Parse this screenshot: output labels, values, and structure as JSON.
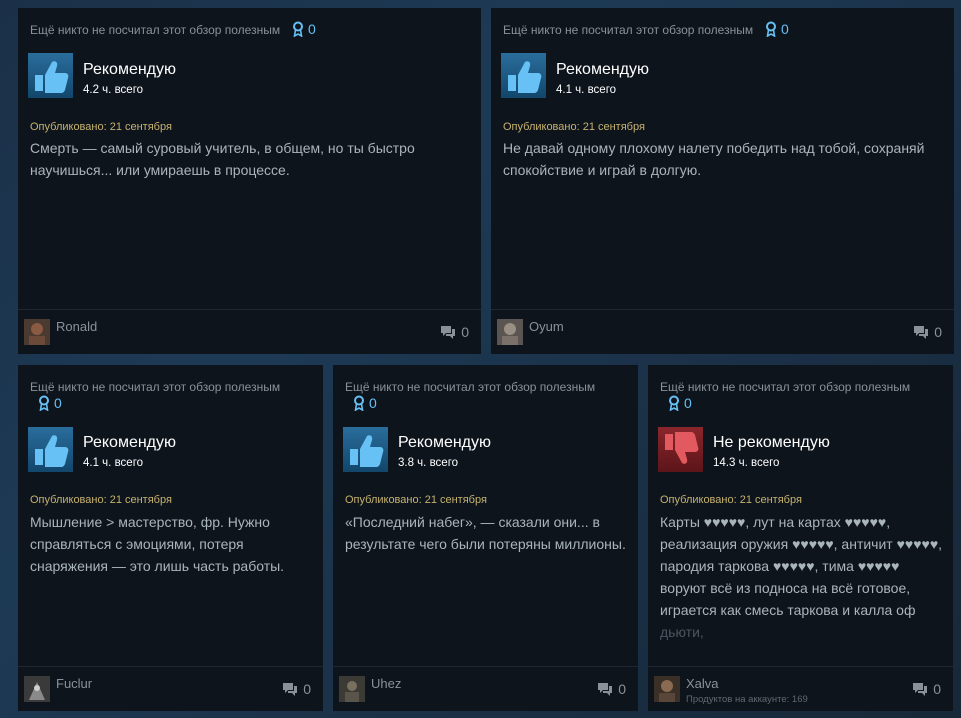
{
  "reviews": [
    {
      "helpful_text": "Ещё никто не посчитал этот обзор полезным",
      "award_count": "0",
      "verdict": "Рекомендую",
      "recommended": true,
      "hours": "4.2 ч. всего",
      "posted": "Опубликовано: 21 сентября",
      "text": "Смерть — самый суровый учитель, в общем, но ты быстро научишься... или умираешь в процессе.",
      "author": "Ronald",
      "comment_count": "0"
    },
    {
      "helpful_text": "Ещё никто не посчитал этот обзор полезным",
      "award_count": "0",
      "verdict": "Рекомендую",
      "recommended": true,
      "hours": "4.1 ч. всего",
      "posted": "Опубликовано: 21 сентября",
      "text": "Не давай одному плохому налету победить над тобой, сохраняй спокойствие и играй в долгую.",
      "author": "Oyum",
      "comment_count": "0"
    },
    {
      "helpful_text": "Ещё никто не посчитал этот обзор полезным",
      "award_count": "0",
      "verdict": "Рекомендую",
      "recommended": true,
      "hours": "4.1 ч. всего",
      "posted": "Опубликовано: 21 сентября",
      "text": "Мышление > мастерство, фр. Нужно справляться с эмоциями, потеря снаряжения — это лишь часть работы.",
      "author": "Fuclur",
      "comment_count": "0"
    },
    {
      "helpful_text": "Ещё никто не посчитал этот обзор полезным",
      "award_count": "0",
      "verdict": "Рекомендую",
      "recommended": true,
      "hours": "3.8 ч. всего",
      "posted": "Опубликовано: 21 сентября",
      "text": "«Последний набег», — сказали они... в результате чего были потеряны миллионы.",
      "author": "Uhez",
      "comment_count": "0"
    },
    {
      "helpful_text": "Ещё никто не посчитал этот обзор полезным",
      "award_count": "0",
      "verdict": "Не рекомендую",
      "recommended": false,
      "hours": "14.3 ч. всего",
      "posted": "Опубликовано: 21 сентября",
      "text_lines": [
        "Карты ♥♥♥♥♥, лут на картах ♥♥♥♥♥,",
        "реализация оружия ♥♥♥♥♥, античит ♥♥♥♥♥,",
        "пародия таркова ♥♥♥♥♥, тима ♥♥♥♥♥",
        "воруют всё из подноса на всё готовое,",
        "играется как смесь таркова и калла оф",
        "дьюти,"
      ],
      "author": "Xalva",
      "products": "Продуктов на аккаунте: 169",
      "comment_count": "0"
    }
  ],
  "colors": {
    "background": "#1b3048",
    "card": "#0e141c",
    "award": "#66c0f4",
    "posted": "#c6b26f",
    "review_text": "#aab4bd",
    "thumb_up_bg": "#1b5a86",
    "thumb_down_bg": "#7a1f24"
  },
  "icons": {
    "award": "award-icon",
    "thumb_up": "thumbs-up-icon",
    "thumb_down": "thumbs-down-icon",
    "comment": "comment-icon"
  }
}
